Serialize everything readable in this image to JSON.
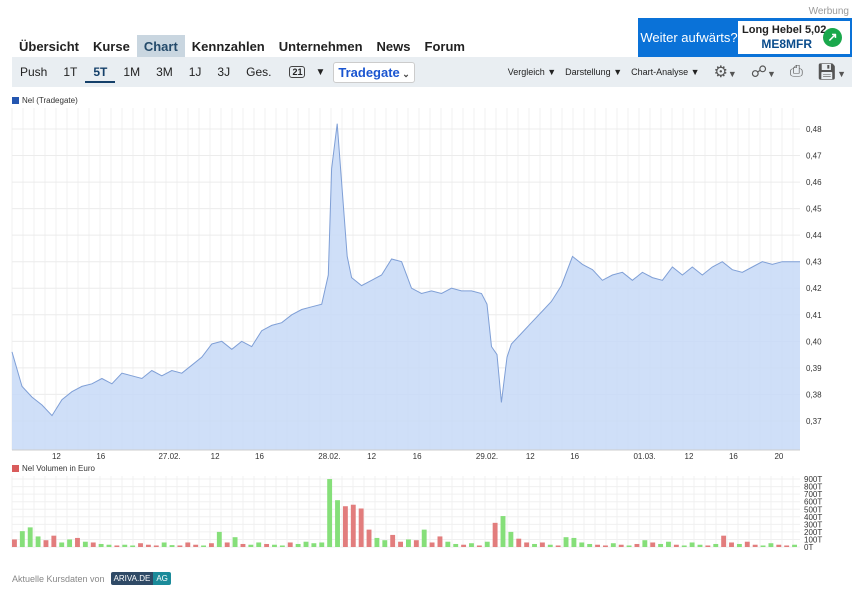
{
  "ad": {
    "label": "Werbung",
    "question": "Weiter aufwärts?",
    "product": "Long Hebel 5,02",
    "code": "ME8MFR"
  },
  "nav": [
    "Übersicht",
    "Kurse",
    "Chart",
    "Kennzahlen",
    "Unternehmen",
    "News",
    "Forum"
  ],
  "ranges": [
    "Push",
    "1T",
    "5T",
    "1M",
    "3M",
    "1J",
    "3J",
    "Ges."
  ],
  "calendar": "21",
  "exchange": "Tradegate",
  "menus": [
    "Vergleich",
    "Darstellung",
    "Chart-Analyse"
  ],
  "footer": {
    "text": "Aktuelle Kursdaten von",
    "brand": "ARIVA.DE",
    "suffix": "AG"
  },
  "colors": {
    "accent": "#0a72d8",
    "area": "#c7d9f7",
    "line": "#7f9fd6",
    "up": "#86df7a",
    "down": "#e27d7d"
  },
  "chart_data": [
    {
      "type": "area",
      "title": "Nel (Tradegate)",
      "ylim": [
        0.36,
        0.488
      ],
      "xlim": [
        0,
        71
      ],
      "yticks": [
        "0,37",
        "0,38",
        "0,39",
        "0,40",
        "0,41",
        "0,42",
        "0,43",
        "0,44",
        "0,45",
        "0,46",
        "0,47",
        "0,48"
      ],
      "xticks": [
        {
          "v": 4.0,
          "l": "12"
        },
        {
          "v": 8.0,
          "l": "16"
        },
        {
          "v": 14.2,
          "l": "27.02."
        },
        {
          "v": 18.3,
          "l": "12"
        },
        {
          "v": 22.3,
          "l": "16"
        },
        {
          "v": 28.6,
          "l": "28.02."
        },
        {
          "v": 32.4,
          "l": "12"
        },
        {
          "v": 36.5,
          "l": "16"
        },
        {
          "v": 42.8,
          "l": "29.02."
        },
        {
          "v": 46.7,
          "l": "12"
        },
        {
          "v": 50.7,
          "l": "16"
        },
        {
          "v": 57.0,
          "l": "01.03."
        },
        {
          "v": 61.0,
          "l": "12"
        },
        {
          "v": 65.0,
          "l": "16"
        },
        {
          "v": 69.1,
          "l": "20"
        }
      ],
      "x": [
        0,
        0.9,
        1.8,
        2.7,
        3.6,
        4.5,
        5.4,
        6.3,
        7.2,
        8.1,
        9.0,
        9.9,
        10.8,
        11.7,
        12.6,
        13.5,
        14.4,
        15.3,
        16.2,
        17.1,
        18.0,
        18.9,
        19.8,
        20.7,
        21.6,
        22.5,
        23.4,
        24.3,
        25.2,
        26.1,
        27.0,
        27.9,
        28.5,
        28.8,
        29.3,
        29.7,
        30.2,
        30.6,
        31.5,
        32.4,
        33.3,
        34.2,
        35.1,
        36.0,
        36.9,
        37.8,
        38.7,
        39.6,
        40.5,
        41.4,
        42.3,
        42.8,
        43.2,
        43.7,
        44.1,
        44.6,
        45.0,
        45.9,
        46.8,
        47.7,
        48.6,
        49.5,
        50.5,
        51.4,
        52.3,
        53.2,
        54.1,
        55.0,
        55.9,
        56.8,
        57.7,
        58.6,
        59.5,
        60.4,
        61.3,
        62.2,
        63.1,
        64.0,
        64.9,
        65.8,
        66.7,
        67.6,
        68.5,
        69.4,
        70.3,
        71
      ],
      "y": [
        0.396,
        0.383,
        0.379,
        0.376,
        0.372,
        0.378,
        0.381,
        0.383,
        0.384,
        0.386,
        0.384,
        0.388,
        0.387,
        0.386,
        0.389,
        0.387,
        0.389,
        0.388,
        0.391,
        0.394,
        0.399,
        0.4,
        0.397,
        0.4,
        0.398,
        0.404,
        0.406,
        0.407,
        0.41,
        0.412,
        0.413,
        0.414,
        0.425,
        0.465,
        0.482,
        0.46,
        0.432,
        0.424,
        0.421,
        0.423,
        0.425,
        0.431,
        0.43,
        0.42,
        0.418,
        0.419,
        0.418,
        0.42,
        0.419,
        0.419,
        0.418,
        0.414,
        0.398,
        0.395,
        0.377,
        0.394,
        0.399,
        0.403,
        0.407,
        0.411,
        0.415,
        0.421,
        0.432,
        0.429,
        0.427,
        0.423,
        0.425,
        0.426,
        0.423,
        0.426,
        0.424,
        0.423,
        0.428,
        0.425,
        0.428,
        0.425,
        0.428,
        0.43,
        0.427,
        0.426,
        0.428,
        0.43,
        0.429,
        0.43,
        0.43,
        0.43
      ]
    },
    {
      "type": "bar",
      "title": "Nel Volumen in Euro",
      "ylim": [
        0,
        900
      ],
      "yunit": "T",
      "yticks": [
        "0T",
        "100T",
        "200T",
        "300T",
        "400T",
        "500T",
        "600T",
        "700T",
        "800T",
        "900T"
      ],
      "values": [
        100,
        210,
        260,
        140,
        90,
        150,
        60,
        100,
        120,
        70,
        60,
        40,
        30,
        20,
        30,
        20,
        50,
        30,
        20,
        60,
        25,
        20,
        60,
        30,
        20,
        50,
        200,
        60,
        130,
        40,
        30,
        60,
        40,
        30,
        20,
        60,
        40,
        70,
        50,
        60,
        900,
        620,
        540,
        560,
        510,
        230,
        120,
        90,
        160,
        70,
        100,
        90,
        230,
        60,
        140,
        70,
        40,
        30,
        50,
        20,
        70,
        320,
        410,
        200,
        110,
        60,
        40,
        60,
        30,
        20,
        130,
        120,
        60,
        40,
        30,
        20,
        50,
        30,
        20,
        40,
        90,
        60,
        40,
        70,
        30,
        20,
        60,
        30,
        20,
        40,
        150,
        60,
        40,
        70,
        30,
        20,
        50,
        30,
        20,
        30
      ],
      "direction": "duuudduududuuduuddduudddudududuuduuduuuuuudddduuddududduudududuuddududuuuuddudududuuduuududdudduuddudd"
    }
  ]
}
